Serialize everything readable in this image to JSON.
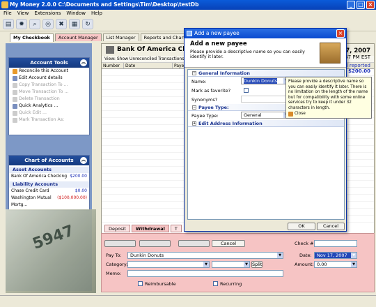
{
  "window": {
    "title": "My Money 2.0.0 C:\\Documents and Settings\\Tim\\Desktop\\testDb"
  },
  "menu": [
    "File",
    "View",
    "Extensions",
    "Window",
    "Help"
  ],
  "toolbar_icons": [
    "folder-icon",
    "lightbulb-icon",
    "search-icon",
    "globe-icon",
    "cross-icon",
    "chart-icon",
    "refresh-icon"
  ],
  "tabs": [
    "My Checkbook",
    "Account Manager",
    "List Manager",
    "Reports and Charts"
  ],
  "account_tools": {
    "title": "Account Tools",
    "items": [
      {
        "label": "Reconcile this Account",
        "enabled": true
      },
      {
        "label": "Edit Account details",
        "enabled": true
      },
      {
        "label": "Copy Transaction To ...",
        "enabled": false
      },
      {
        "label": "Move Transaction To ...",
        "enabled": false
      },
      {
        "label": "Delete Transaction",
        "enabled": false
      },
      {
        "label": "Quick Analytics ...",
        "enabled": true
      },
      {
        "label": "Quick Edit ...",
        "enabled": false
      },
      {
        "label": "Mark Transaction As:",
        "enabled": false
      }
    ]
  },
  "chart_of_accounts": {
    "title": "Chart of Accounts",
    "asset_title": "Asset Accounts",
    "assets": [
      {
        "name": "Bank Of America Checking",
        "amount": "$200.00"
      }
    ],
    "liability_title": "Liability Accounts",
    "liabilities": [
      {
        "name": "Chase Credit Card",
        "amount": "$0.00"
      },
      {
        "name": "Washington Mutual Mortg...",
        "amount": "($100,000.00)"
      }
    ]
  },
  "main": {
    "title": "Bank Of America Checking",
    "view_label": "View: Show Unreconciled Transactions,Sort",
    "columns": [
      "Number",
      "Date",
      "Paye"
    ],
    "date": "Nov 17, 2007",
    "time": "12:47 PM EST",
    "reported_label": "l reported",
    "balance": "$200.00"
  },
  "tx_tabs": [
    "Deposit",
    "Withdrawal",
    "T"
  ],
  "form": {
    "cancel": "Cancel",
    "check_label": "Check #:",
    "check_value": "",
    "payto_label": "Pay To:",
    "payto_value": "Dunkin Donuts",
    "date_label": "Date:",
    "date_value": "Nov 17, 2007",
    "category_label": "Category:",
    "split": "Split",
    "amount_label": "Amount:",
    "amount_value": "0.00",
    "memo_label": "Memo:",
    "reimbursable": "Reimbursable",
    "recurring": "Recurring"
  },
  "dialog": {
    "title": "Add a new payee",
    "heading": "Add a new payee",
    "subheading": "Please provide a descriptive name so you can easily identify it later.",
    "general": "General Information",
    "name_label": "Name:",
    "name_value": "Dunkin Donuts",
    "favorite_label": "Mark as favorite?",
    "synonyms_label": "Synonyms?",
    "payee_type_group": "Payee Type:",
    "payee_type_label": "Payee Type:",
    "payee_type_value": "General",
    "address_group": "Edit Address Information",
    "ok": "OK",
    "cancel": "Cancel"
  },
  "tooltip": {
    "text": "Please provide a descriptive name so you can easily identify it later. There is no limitation on the length of the name but for compatibility with some online services try to keep it under 32 characters in length.",
    "close": "Close"
  }
}
